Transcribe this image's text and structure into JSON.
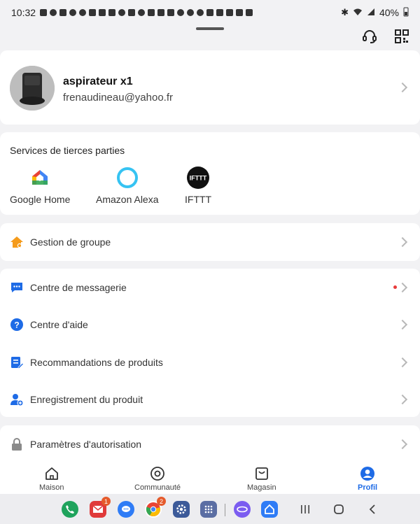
{
  "status_bar": {
    "time": "10:32",
    "battery": "40%"
  },
  "profile": {
    "name": "aspirateur x1",
    "email": "frenaudineau@yahoo.fr"
  },
  "services": {
    "title": "Services de tierces parties",
    "items": [
      {
        "label": "Google Home",
        "icon": "google-home-icon"
      },
      {
        "label": "Amazon Alexa",
        "icon": "alexa-icon"
      },
      {
        "label": "IFTTT",
        "icon": "ifttt-icon",
        "logo_text": "IFTTT"
      }
    ]
  },
  "menu": {
    "group": {
      "label": "Gestion de groupe",
      "icon": "home-gear-icon"
    },
    "items": [
      {
        "label": "Centre de messagerie",
        "icon": "message-icon"
      },
      {
        "label": "Centre d'aide",
        "icon": "help-icon"
      },
      {
        "label": "Recommandations de produits",
        "icon": "edit-doc-icon"
      },
      {
        "label": "Enregistrement du produit",
        "icon": "person-add-icon"
      }
    ],
    "permissions": {
      "label": "Paramètres d'autorisation",
      "icon": "lock-icon"
    }
  },
  "bottom_nav": {
    "items": [
      {
        "label": "Maison"
      },
      {
        "label": "Communauté"
      },
      {
        "label": "Magasin"
      },
      {
        "label": "Profil"
      }
    ],
    "active": "Profil"
  },
  "dock": {
    "badges": {
      "mail": "1",
      "chrome": "2"
    }
  },
  "colors": {
    "accent": "#1e6be6",
    "group_icon": "#f59b1b",
    "menu_icon": "#1e6be6",
    "lock_icon": "#8a8a8a",
    "unread_dot": "#e83b3b"
  }
}
